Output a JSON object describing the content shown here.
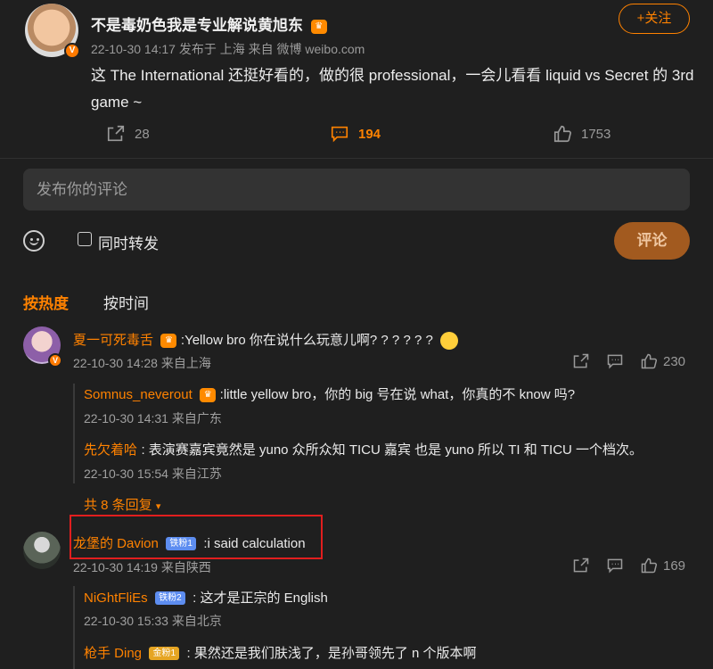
{
  "post": {
    "author": "不是毒奶色我是专业解说黄旭东",
    "meta": "22-10-30 14:17  发布于 上海  来自 微博 weibo.com",
    "text": "这 The International 还挺好看的，做的很 professional，一会儿看看 liquid vs Secret 的 3rd game ~",
    "follow_label": "+关注",
    "reposts": "28",
    "comments": "194",
    "likes": "1753",
    "verified_mark": "V"
  },
  "composer": {
    "placeholder": "发布你的评论",
    "repost_label": "同时转发",
    "submit_label": "评论"
  },
  "tabs": [
    "按热度",
    "按时间"
  ],
  "comments": [
    {
      "name": "夏一可死毒舌",
      "text": ":Yellow bro 你在说什么玩意儿啊? ? ? ? ? ?",
      "time": "22-10-30 14:28 来自上海",
      "likes": "230",
      "replies": [
        {
          "name": "Somnus_neverout",
          "text": ":little yellow bro，你的 big 号在说 what，你真的不 know 吗?",
          "time": "22-10-30 14:31 来自广东"
        },
        {
          "name": "先欠着哈",
          "text": ": 表演赛嘉宾竟然是 yuno  众所众知 TICU 嘉宾  也是 yuno  所以 TI 和 TICU 一个档次。",
          "time": "22-10-30 15:54 来自江苏"
        }
      ],
      "more": "共 8 条回复"
    },
    {
      "name": "龙堡的 Davion",
      "badge": "铁粉1",
      "text": ":i said calculation",
      "time": "22-10-30 14:19 来自陕西",
      "likes": "169",
      "replies": [
        {
          "name": "NiGhtFliEs",
          "badge": "铁粉2",
          "text": ": 这才是正宗的 English",
          "time": "22-10-30 15:33 来自北京"
        },
        {
          "name": "枪手 Ding",
          "badge": "金粉1",
          "text": ": 果然还是我们肤浅了，是孙哥领先了 n 个版本啊",
          "time": ""
        }
      ]
    }
  ],
  "colors": {
    "accent": "#ff8200",
    "background": "#1f1f1f",
    "highlight": "#e11e1e"
  },
  "icons": [
    "repost-icon",
    "comment-icon",
    "like-icon",
    "emoji-icon",
    "share-icon",
    "reply-icon",
    "crown-icon",
    "verified-icon"
  ]
}
